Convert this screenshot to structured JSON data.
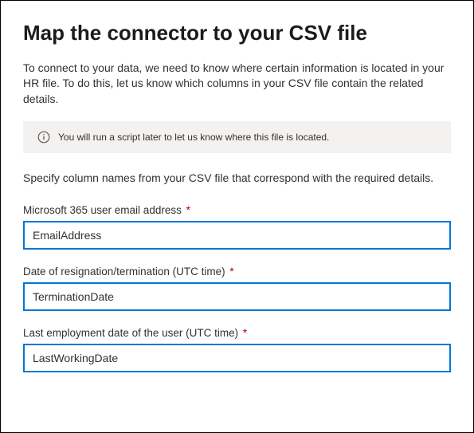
{
  "heading": "Map the connector to your CSV file",
  "intro": "To connect to your data, we need to know where certain information is located in your HR file. To do this, let us know which columns in your CSV file contain the related details.",
  "banner": {
    "text": "You will run a script later to let us know where this file is located."
  },
  "specify": "Specify column names from your CSV file that correspond with the required details.",
  "required_mark": "*",
  "fields": [
    {
      "label": "Microsoft 365 user email address",
      "value": "EmailAddress"
    },
    {
      "label": "Date of resignation/termination (UTC time)",
      "value": "TerminationDate"
    },
    {
      "label": "Last employment date of the user (UTC time)",
      "value": "LastWorkingDate"
    }
  ]
}
